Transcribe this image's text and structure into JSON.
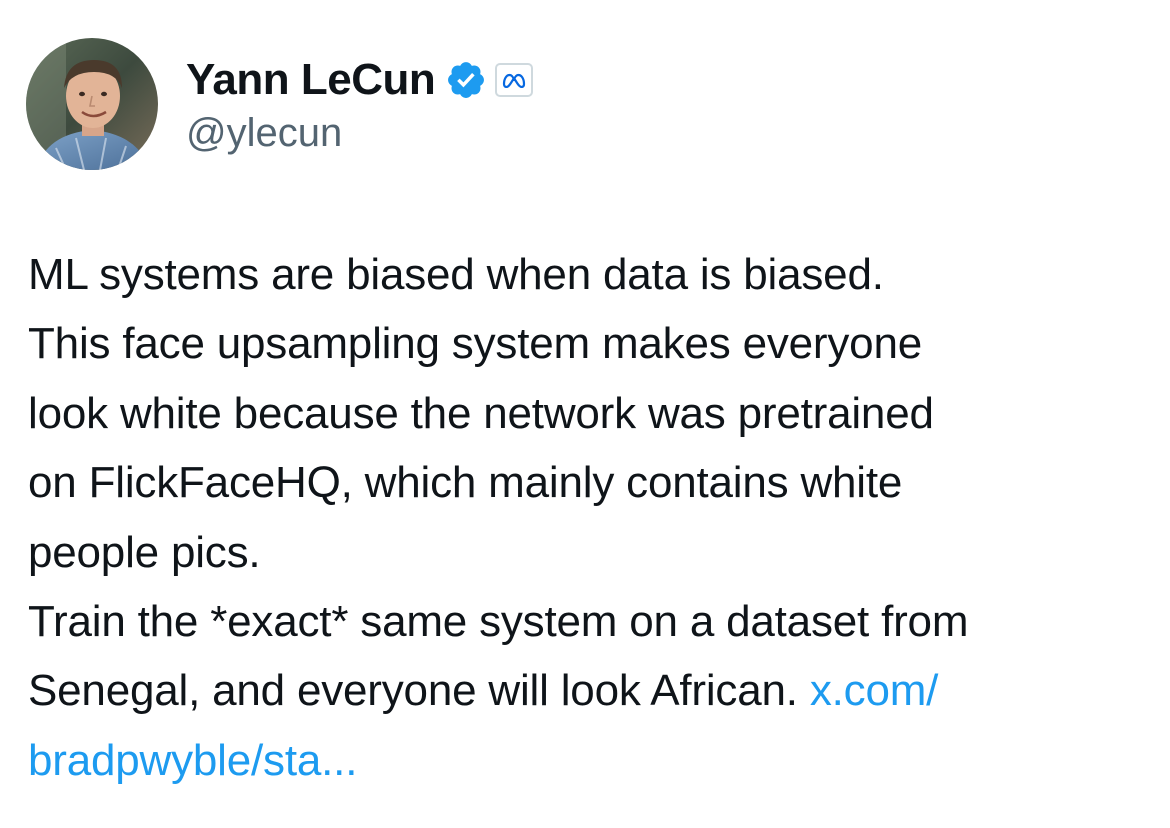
{
  "author": {
    "display_name": "Yann LeCun",
    "handle": "@ylecun",
    "avatar_icon": "profile-photo",
    "verified_icon": "verified-badge-icon",
    "affiliation_icon": "meta-logo-icon"
  },
  "tweet": {
    "lines": [
      "ML systems are biased when data is biased.",
      "This face upsampling system makes everyone",
      "look white because the network was pretrained",
      "on FlickFaceHQ, which mainly contains white",
      "people pics.",
      "Train the *exact* same system on a dataset from",
      "Senegal, and everyone will look African. "
    ],
    "link_part1": "x.com/",
    "link_part2": "bradpwyble/sta..."
  },
  "colors": {
    "text": "#0f1419",
    "secondary": "#536471",
    "link": "#1d9bf0",
    "verified": "#1d9bf0",
    "meta": "#0668e1"
  }
}
